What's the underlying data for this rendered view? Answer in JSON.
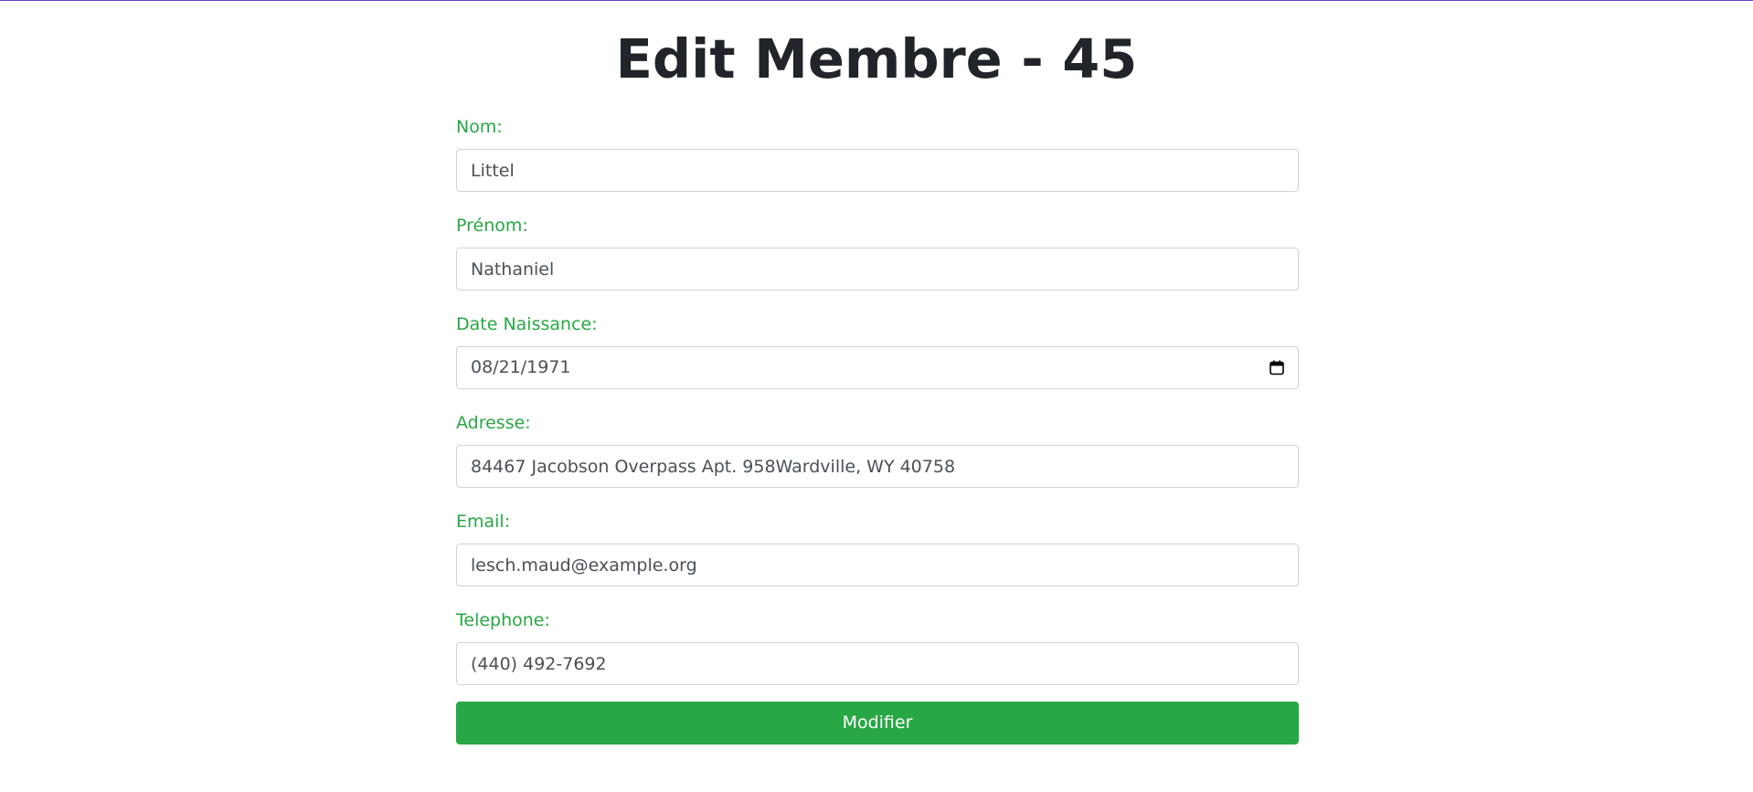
{
  "page": {
    "title": "Edit Membre - 45",
    "accent_color": "#28a745",
    "top_border_color": "#6f42c1"
  },
  "form": {
    "fields": [
      {
        "label": "Nom:",
        "value": "Littel"
      },
      {
        "label": "Prénom:",
        "value": "Nathaniel"
      },
      {
        "label": "Date Naissance:",
        "value": "08/21/1971",
        "icon": "calendar-icon"
      },
      {
        "label": "Adresse:",
        "value": "84467 Jacobson Overpass Apt. 958Wardville, WY 40758"
      },
      {
        "label": "Email:",
        "value": "lesch.maud@example.org"
      },
      {
        "label": "Telephone:",
        "value": "(440) 492-7692"
      }
    ],
    "submit_label": "Modifier"
  }
}
